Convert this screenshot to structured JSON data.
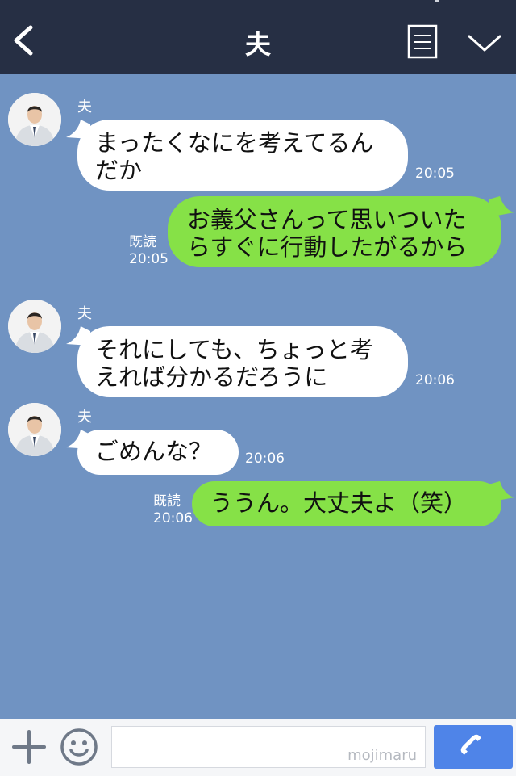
{
  "header": {
    "title": "夫"
  },
  "messages": [
    {
      "sender": "夫",
      "text": "まったくなにを考えてるん\nだか",
      "time": "20:05"
    },
    {
      "text": "お義父さんって思いついた\nらすぐに行動したがるから",
      "read": "既読",
      "time": "20:05"
    },
    {
      "sender": "夫",
      "text": "それにしても、ちょっと考\nえれば分かるだろうに",
      "time": "20:06"
    },
    {
      "sender": "夫",
      "text": "ごめんな？",
      "time": "20:06"
    },
    {
      "text": "ううん。大丈夫よ（笑）",
      "read": "既読",
      "time": "20:06"
    }
  ],
  "footer": {
    "watermark": "mojimaru",
    "input_placeholder": ""
  },
  "colors": {
    "header": "#262f44",
    "background": "#7093c2",
    "incoming": "#ffffff",
    "outgoing": "#86e147",
    "call": "#4f84e8"
  },
  "icons": {
    "back": "chevron-left-icon",
    "menu": "document-menu-icon",
    "collapse": "chevron-down-icon",
    "plus": "plus-icon",
    "emoji": "smiley-icon",
    "call": "phone-icon"
  }
}
